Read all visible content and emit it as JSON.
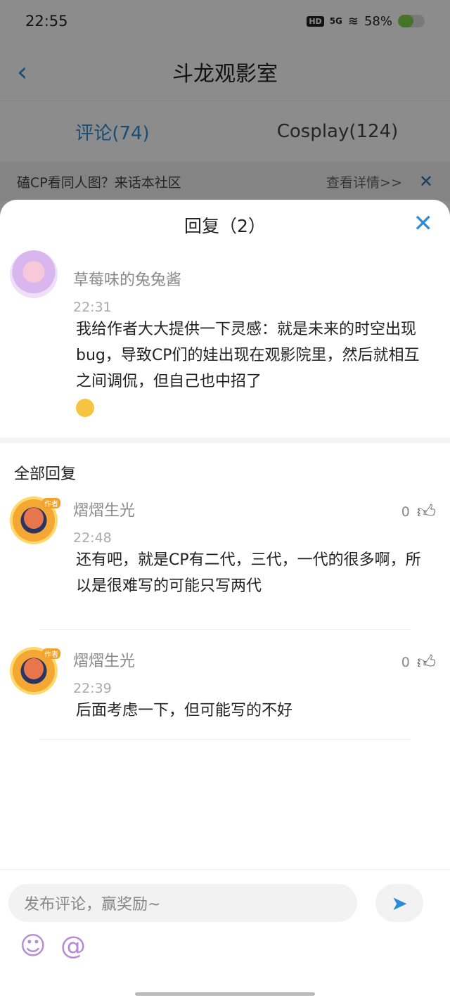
{
  "status_bar": {
    "time": "22:55",
    "hd": "HD",
    "signal": "5G",
    "battery": "58%",
    "battery_level": 0.58
  },
  "nav": {
    "title": "斗龙观影室",
    "back_icon": "back-arrow-icon"
  },
  "tabs": [
    {
      "label": "评论(74)",
      "active": true
    },
    {
      "label": "Cosplay(124)",
      "active": false
    }
  ],
  "banner": {
    "text": "磕CP看同人图？来话本社区",
    "link": "查看详情>>",
    "close": "✕"
  },
  "sheet": {
    "title": "回复（2）",
    "close": "✕",
    "main_comment": {
      "name": "草莓味的兔兔酱",
      "time": "22:31",
      "text": "我给作者大大提供一下灵感：就是未来的时空出现bug，导致CP们的娃出现在观影院里，然后就相互之间调侃，但自己也中招了"
    },
    "section_title": "全部回复",
    "replies": [
      {
        "name": "熠熠生光",
        "time": "22:48",
        "text": "还有吧，就是CP有二代，三代，一代的很多啊，所以是很难写的可能只写两代",
        "likes": "0",
        "tag": "作者"
      },
      {
        "name": "熠熠生光",
        "time": "22:39",
        "text": "后面考虑一下，但可能写的不好",
        "likes": "0",
        "tag": "作者"
      }
    ]
  },
  "input": {
    "placeholder": "发布评论，赢奖励~",
    "emoji_icon": "☺",
    "at_icon": "@"
  }
}
